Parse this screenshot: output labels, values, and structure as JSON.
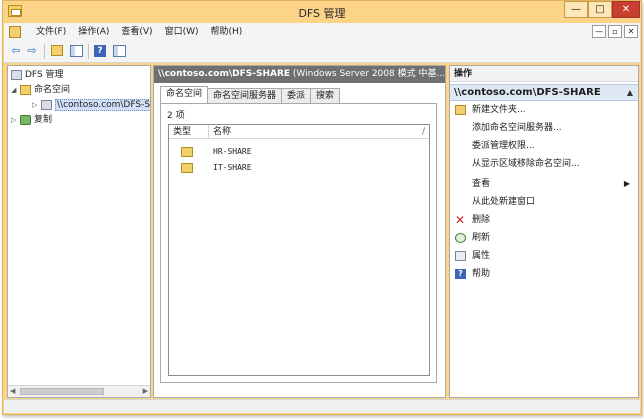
{
  "window": {
    "title": "DFS 管理",
    "minimize": "—",
    "maximize": "□",
    "close": "✕"
  },
  "menu": {
    "items": [
      "文件(F)",
      "操作(A)",
      "查看(V)",
      "窗口(W)",
      "帮助(H)"
    ],
    "mdi_min": "—",
    "mdi_restore": "▫",
    "mdi_close": "✕"
  },
  "toolbar": {
    "back": "⇦",
    "forward": "⇨",
    "help": "?"
  },
  "tree": {
    "root": "DFS 管理",
    "namespaces": "命名空间",
    "share": "\\\\contoso.com\\DFS-SHARE",
    "replication": "复制"
  },
  "center": {
    "header_path": "\\\\contoso.com\\DFS-SHARE",
    "header_mode": "(Windows Server 2008 模式 中基...",
    "tabs": [
      "命名空间",
      "命名空间服务器",
      "委派",
      "搜索"
    ],
    "count": "2 项",
    "columns": {
      "type": "类型",
      "name": "名称"
    },
    "rows": [
      {
        "name": "HR-SHARE"
      },
      {
        "name": "IT-SHARE"
      }
    ]
  },
  "actions": {
    "title": "操作",
    "section": "\\\\contoso.com\\DFS-SHARE",
    "items": [
      {
        "label": "新建文件夹...",
        "icon": "folder-icon"
      },
      {
        "label": "添加命名空间服务器...",
        "icon": ""
      },
      {
        "label": "委派管理权限...",
        "icon": ""
      },
      {
        "label": "从显示区域移除命名空间...",
        "icon": ""
      },
      {
        "label": "查看",
        "icon": "",
        "submenu": true
      },
      {
        "label": "从此处新建窗口",
        "icon": ""
      },
      {
        "label": "删除",
        "icon": "delete-icon"
      },
      {
        "label": "刷新",
        "icon": "refresh-icon"
      },
      {
        "label": "属性",
        "icon": "properties-icon"
      },
      {
        "label": "帮助",
        "icon": "help-icon"
      }
    ]
  }
}
